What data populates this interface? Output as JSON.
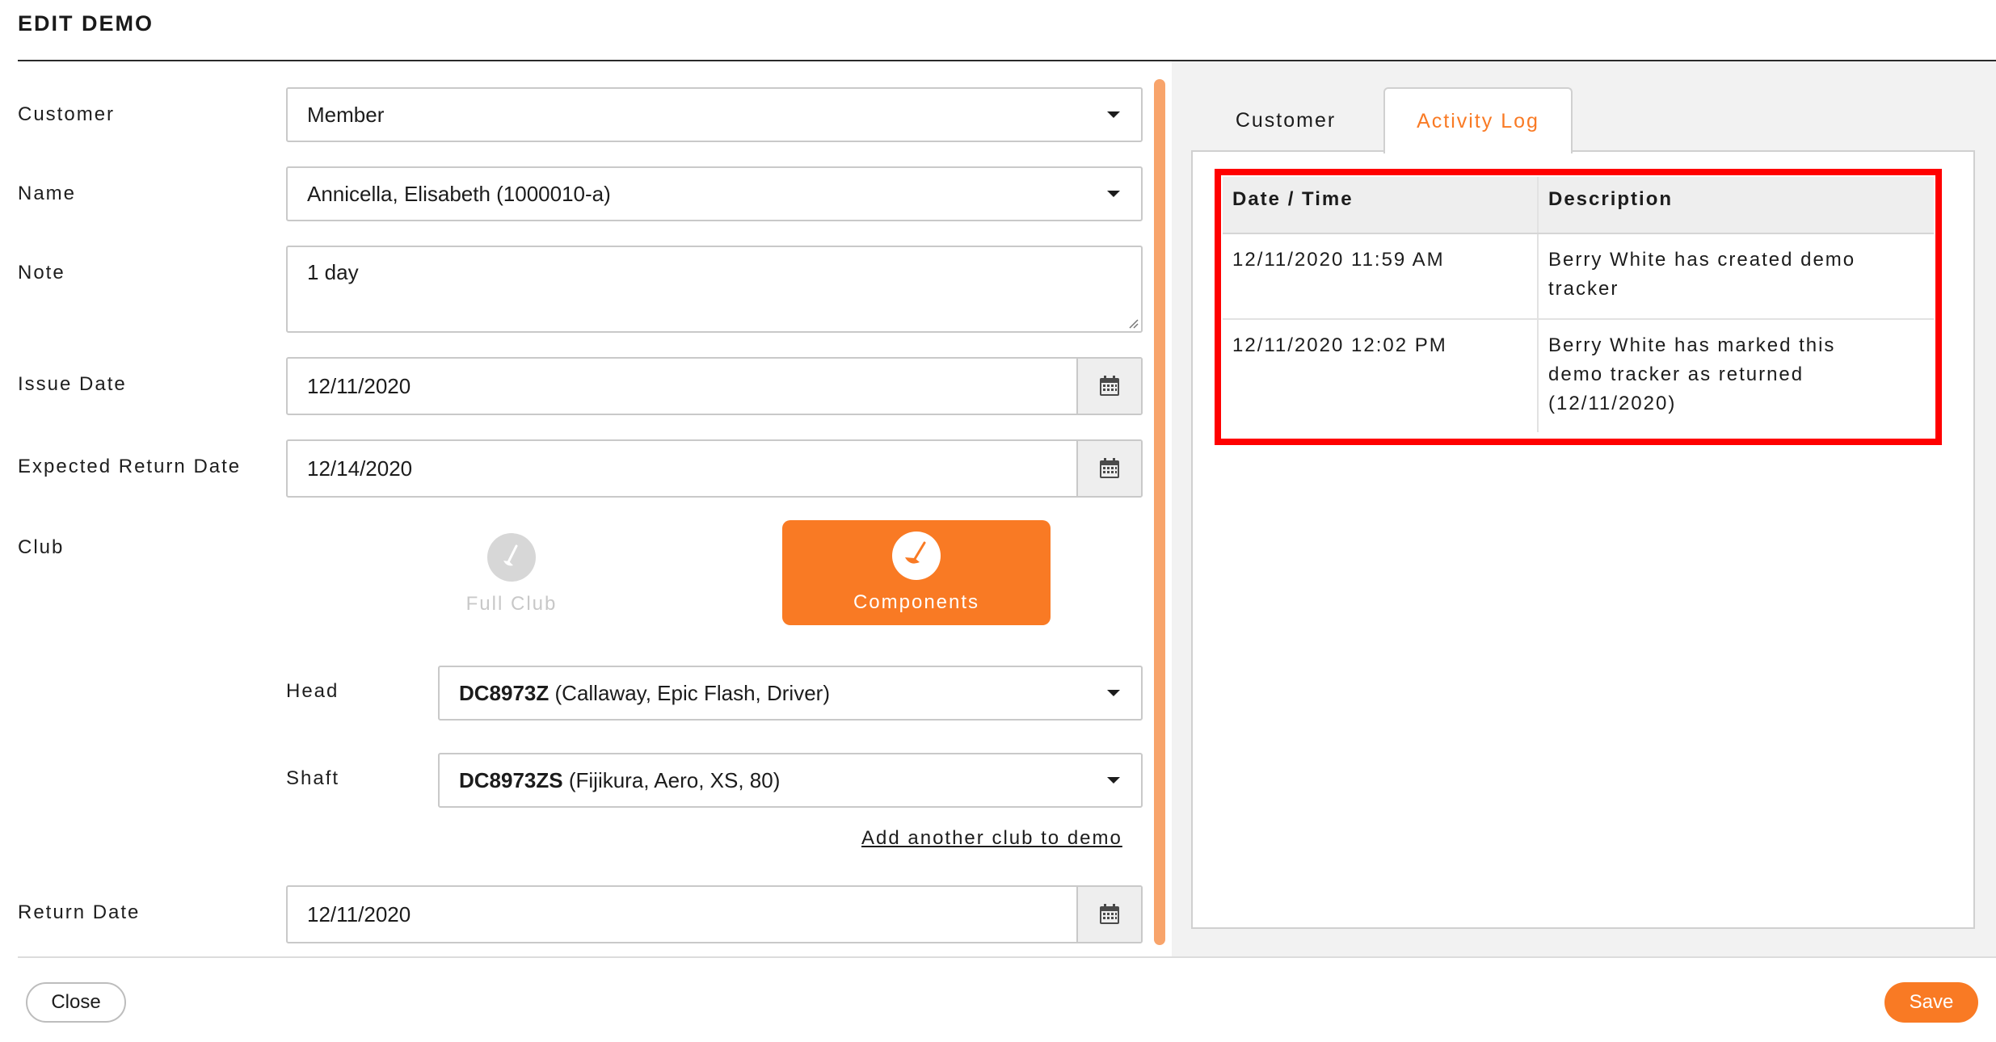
{
  "dialog": {
    "title": "EDIT DEMO"
  },
  "form": {
    "customer": {
      "label": "Customer",
      "value": "Member"
    },
    "name": {
      "label": "Name",
      "value": "Annicella, Elisabeth (1000010-a)"
    },
    "note": {
      "label": "Note",
      "value": "1 day"
    },
    "issue_date": {
      "label": "Issue Date",
      "value": "12/11/2020",
      "icon": "calendar-icon"
    },
    "expected_return_date": {
      "label": "Expected Return Date",
      "value": "12/14/2020",
      "icon": "calendar-icon"
    },
    "club": {
      "label": "Club",
      "options": [
        {
          "label": "Full Club",
          "selected": false,
          "icon": "golf-club-icon"
        },
        {
          "label": "Components",
          "selected": true,
          "icon": "golf-club-icon"
        }
      ]
    },
    "head": {
      "label": "Head",
      "code": "DC8973Z",
      "detail": " (Callaway, Epic Flash, Driver)"
    },
    "shaft": {
      "label": "Shaft",
      "code": "DC8973ZS",
      "detail": " (Fijikura, Aero, XS, 80)"
    },
    "add_club_link": "Add another club to demo",
    "return_date": {
      "label": "Return Date",
      "value": "12/11/2020",
      "icon": "calendar-icon"
    }
  },
  "tabs": [
    {
      "label": "Customer",
      "active": false
    },
    {
      "label": "Activity Log",
      "active": true
    }
  ],
  "activity_log": {
    "columns": [
      "Date / Time",
      "Description"
    ],
    "rows": [
      {
        "datetime": "12/11/2020 11:59 AM",
        "desc_lines": [
          "Berry White has created demo",
          "tracker"
        ]
      },
      {
        "datetime": "12/11/2020 12:02 PM",
        "desc_lines": [
          "Berry White has marked this",
          "demo tracker as returned",
          "(12/11/2020)"
        ]
      }
    ]
  },
  "footer": {
    "close_label": "Close",
    "save_label": "Save"
  },
  "colors": {
    "accent": "#f97a24",
    "highlight": "#ff0000",
    "panel_bg": "#f2f2f2",
    "header_bg": "#eeeeee"
  }
}
